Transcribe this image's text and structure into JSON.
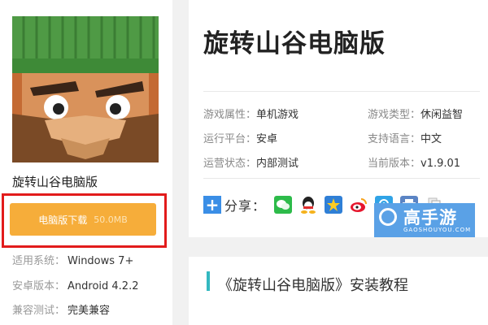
{
  "game": {
    "name": "旋转山谷电脑版"
  },
  "download": {
    "label": "电脑版下载",
    "size": "50.0MB"
  },
  "system_info": [
    {
      "key": "适用系统：",
      "value": "Windows 7+"
    },
    {
      "key": "安卓版本：",
      "value": "Android 4.2.2"
    },
    {
      "key": "兼容测试：",
      "value": "完美兼容"
    }
  ],
  "title": "旋转山谷电脑版",
  "info": [
    {
      "key": "游戏属性：",
      "value": "单机游戏"
    },
    {
      "key": "游戏类型：",
      "value": "休闲益智"
    },
    {
      "key": "运行平台：",
      "value": "安卓"
    },
    {
      "key": "支持语言：",
      "value": "中文"
    },
    {
      "key": "运营状态：",
      "value": "内部测试"
    },
    {
      "key": "当前版本：",
      "value": "v1.9.01"
    }
  ],
  "share": {
    "label": "分享：",
    "icons": [
      "wechat-icon",
      "qq-icon",
      "qzone-icon",
      "weibo-icon",
      "tencent-weibo-icon",
      "print-icon",
      "copy-icon"
    ]
  },
  "logo": {
    "text": "高手游",
    "sub": "GAOSHOUYOU.COM"
  },
  "tutorial": {
    "title": "《旋转山谷电脑版》安装教程"
  },
  "colors": {
    "download_button": "#f6ad3a",
    "highlight_border": "#e21b1b",
    "accent_bar": "#33b8c0",
    "logo_bg": "#5aa1e6"
  }
}
